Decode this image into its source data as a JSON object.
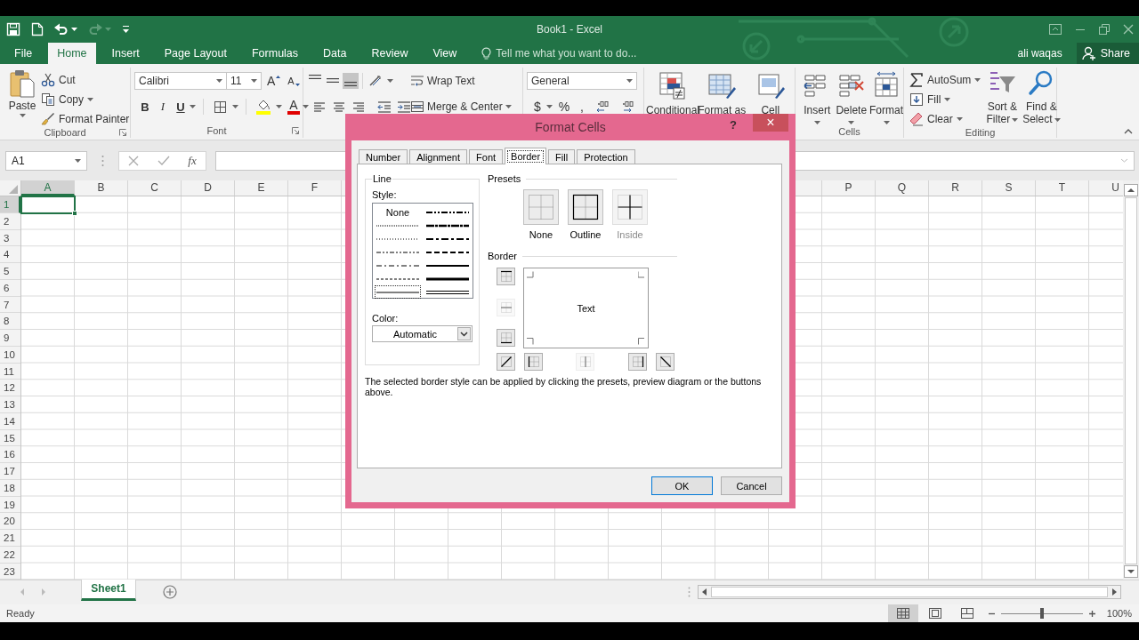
{
  "title_bar": {
    "title": "Book1 - Excel"
  },
  "ribbon_tabs": [
    {
      "label": "File",
      "selected": false
    },
    {
      "label": "Home",
      "selected": true
    },
    {
      "label": "Insert",
      "selected": false
    },
    {
      "label": "Page Layout",
      "selected": false
    },
    {
      "label": "Formulas",
      "selected": false
    },
    {
      "label": "Data",
      "selected": false
    },
    {
      "label": "Review",
      "selected": false
    },
    {
      "label": "View",
      "selected": false
    }
  ],
  "tell_me": {
    "placeholder": "Tell me what you want to do..."
  },
  "account": {
    "user": "ali waqas",
    "share": "Share"
  },
  "clipboard": {
    "label": "Clipboard",
    "paste": "Paste",
    "cut": "Cut",
    "copy": "Copy",
    "format_painter": "Format Painter"
  },
  "font": {
    "label": "Font",
    "name": "Calibri",
    "size": "11",
    "grow": "A",
    "shrink": "A",
    "bold": "B",
    "italic": "I",
    "underline": "U",
    "font_color_button": "A"
  },
  "alignment": {
    "vertical": [
      {
        "selected": false
      },
      {
        "selected": false
      },
      {
        "selected": true
      }
    ],
    "wrap_text": "Wrap Text",
    "merge": "Merge & Center"
  },
  "number": {
    "format": "General",
    "currency": "$",
    "percent": "%",
    "comma": ","
  },
  "styles": {
    "buttons": [
      "Conditional",
      "Format as",
      "Cell"
    ]
  },
  "cells": {
    "label": "Cells",
    "buttons": [
      "Insert",
      "Delete",
      "Format"
    ]
  },
  "editing": {
    "label": "Editing",
    "autosum": "AutoSum",
    "fill": "Fill",
    "clear": "Clear",
    "sort": "Sort & Filter",
    "find": "Find & Select"
  },
  "formula_bar": {
    "name_box": "A1",
    "insert_function": "fx"
  },
  "columns_left": [
    {
      "label": "A",
      "selected": true
    },
    {
      "label": "B",
      "selected": false
    },
    {
      "label": "C",
      "selected": false
    },
    {
      "label": "D",
      "selected": false
    },
    {
      "label": "E",
      "selected": false
    },
    {
      "label": "F",
      "selected": false
    }
  ],
  "columns_right": [
    {
      "label": "P",
      "selected": false
    },
    {
      "label": "Q",
      "selected": false
    },
    {
      "label": "R",
      "selected": false
    },
    {
      "label": "S",
      "selected": false
    },
    {
      "label": "T",
      "selected": false
    },
    {
      "label": "U",
      "selected": false
    }
  ],
  "rows": [
    {
      "label": "1",
      "selected": true
    },
    {
      "label": "2",
      "selected": false
    },
    {
      "label": "3",
      "selected": false
    },
    {
      "label": "4",
      "selected": false
    },
    {
      "label": "5",
      "selected": false
    },
    {
      "label": "6",
      "selected": false
    },
    {
      "label": "7",
      "selected": false
    },
    {
      "label": "8",
      "selected": false
    },
    {
      "label": "9",
      "selected": false
    },
    {
      "label": "10",
      "selected": false
    },
    {
      "label": "11",
      "selected": false
    },
    {
      "label": "12",
      "selected": false
    },
    {
      "label": "13",
      "selected": false
    },
    {
      "label": "14",
      "selected": false
    },
    {
      "label": "15",
      "selected": false
    },
    {
      "label": "16",
      "selected": false
    },
    {
      "label": "17",
      "selected": false
    },
    {
      "label": "18",
      "selected": false
    },
    {
      "label": "19",
      "selected": false
    },
    {
      "label": "20",
      "selected": false
    },
    {
      "label": "21",
      "selected": false
    },
    {
      "label": "22",
      "selected": false
    },
    {
      "label": "23",
      "selected": false
    }
  ],
  "sheets": [
    {
      "label": "Sheet1",
      "selected": true
    }
  ],
  "status_bar": {
    "text": "Ready",
    "views": [
      {
        "selected": true
      },
      {
        "selected": false
      },
      {
        "selected": false
      }
    ],
    "zoom": {
      "level": 0.5,
      "reading": "100%"
    }
  },
  "dialog": {
    "title": "Format Cells",
    "help": "?",
    "close": "×",
    "tabs": [
      {
        "label": "Number",
        "selected": false
      },
      {
        "label": "Alignment",
        "selected": false
      },
      {
        "label": "Font",
        "selected": false
      },
      {
        "label": "Border",
        "selected": true
      },
      {
        "label": "Fill",
        "selected": false
      },
      {
        "label": "Protection",
        "selected": false
      }
    ],
    "line": {
      "label": "Line",
      "style_label": "Style:",
      "styles": [
        {
          "kind": "none",
          "label": "None",
          "selected": false
        },
        {
          "kind": "hair",
          "selected": false
        },
        {
          "kind": "dotted",
          "selected": false
        },
        {
          "kind": "dash-dot-dot",
          "selected": false
        },
        {
          "kind": "dash-dot",
          "selected": false
        },
        {
          "kind": "dashed",
          "selected": false
        },
        {
          "kind": "thin",
          "selected": true
        },
        {
          "kind": "medium-dash-dot-dot",
          "selected": false
        },
        {
          "kind": "slant-dash-dot",
          "selected": false
        },
        {
          "kind": "medium-dash-dot",
          "selected": false
        },
        {
          "kind": "medium-dashed",
          "selected": false
        },
        {
          "kind": "medium",
          "selected": false
        },
        {
          "kind": "thick",
          "selected": false
        },
        {
          "kind": "double",
          "selected": false
        }
      ],
      "color_label": "Color:",
      "color_choice": "Automatic"
    },
    "presets": {
      "label": "Presets",
      "items": [
        {
          "label": "None",
          "disabled": false
        },
        {
          "label": "Outline",
          "disabled": false
        },
        {
          "label": "Inside",
          "disabled": true
        }
      ]
    },
    "border": {
      "label": "Border",
      "preview_text": "Text",
      "side_buttons": [
        {
          "kind": "top",
          "disabled": false
        },
        {
          "kind": "inside-horizontal",
          "disabled": true
        },
        {
          "kind": "bottom",
          "disabled": false
        }
      ],
      "bottom_buttons": [
        {
          "kind": "diagonal-up",
          "disabled": false
        },
        {
          "kind": "left",
          "disabled": false
        },
        {
          "kind": "inside-vertical",
          "disabled": true
        },
        {
          "kind": "right",
          "disabled": false
        },
        {
          "kind": "diagonal-down",
          "disabled": false
        }
      ]
    },
    "hint": "The selected border style can be applied by clicking the presets, preview diagram or the buttons above.",
    "buttons": [
      {
        "label": "OK",
        "default": true
      },
      {
        "label": "Cancel",
        "default": false
      }
    ]
  }
}
